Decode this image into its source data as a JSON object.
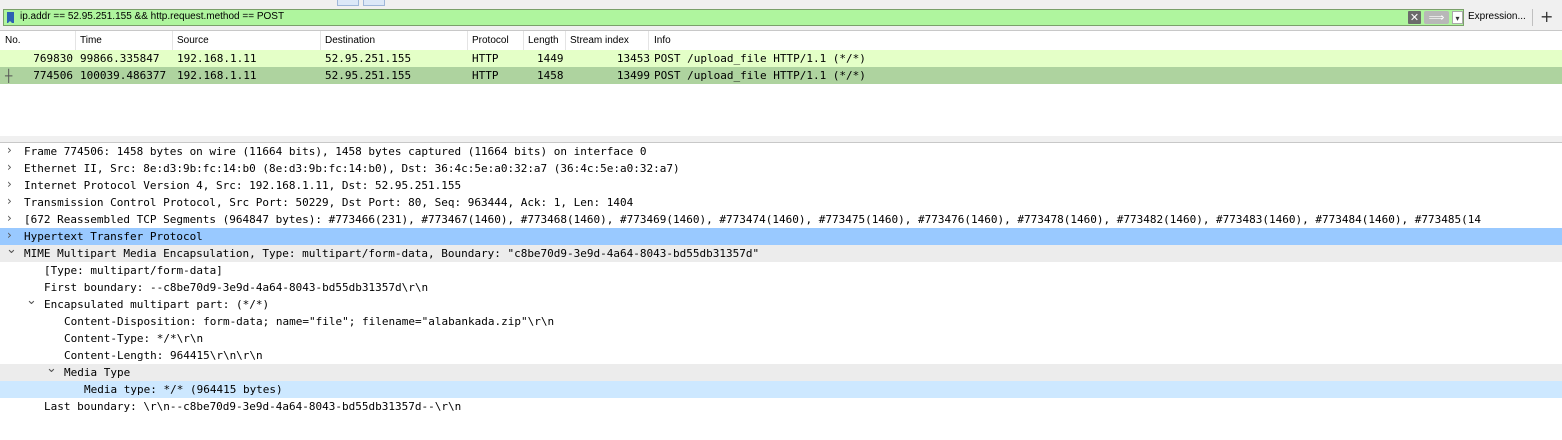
{
  "filter": {
    "value": "ip.addr == 52.95.251.155 && http.request.method == POST",
    "expression_label": "Expression...",
    "add_label": "+",
    "clear_glyph": "✕",
    "apply_glyph": "⟹",
    "dropdown_glyph": "▾"
  },
  "packet_list": {
    "columns": [
      "No.",
      "Time",
      "Source",
      "Destination",
      "Protocol",
      "Length",
      "Stream index",
      "Info"
    ],
    "rows": [
      {
        "no": "769830",
        "time": "99866.335847",
        "source": "192.168.1.11",
        "destination": "52.95.251.155",
        "protocol": "HTTP",
        "length": "1449",
        "stream": "13453",
        "info": "POST /upload_file HTTP/1.1  (*/*)"
      },
      {
        "no": "774506",
        "time": "100039.486377",
        "source": "192.168.1.11",
        "destination": "52.95.251.155",
        "protocol": "HTTP",
        "length": "1458",
        "stream": "13499",
        "info": "POST /upload_file HTTP/1.1  (*/*)"
      }
    ]
  },
  "details": {
    "rows": [
      {
        "arrow": "›",
        "text": "Frame 774506: 1458 bytes on wire (11664 bits), 1458 bytes captured (11664 bits) on interface 0"
      },
      {
        "arrow": "›",
        "text": "Ethernet II, Src: 8e:d3:9b:fc:14:b0 (8e:d3:9b:fc:14:b0), Dst: 36:4c:5e:a0:32:a7 (36:4c:5e:a0:32:a7)"
      },
      {
        "arrow": "›",
        "text": "Internet Protocol Version 4, Src: 192.168.1.11, Dst: 52.95.251.155"
      },
      {
        "arrow": "›",
        "text": "Transmission Control Protocol, Src Port: 50229, Dst Port: 80, Seq: 963444, Ack: 1, Len: 1404"
      },
      {
        "arrow": "›",
        "text": "[672 Reassembled TCP Segments (964847 bytes): #773466(231), #773467(1460), #773468(1460), #773469(1460), #773474(1460), #773475(1460), #773476(1460), #773478(1460), #773482(1460), #773483(1460), #773484(1460), #773485(14"
      },
      {
        "arrow": "›",
        "text": "Hypertext Transfer Protocol"
      },
      {
        "arrow": "⌄",
        "text": "MIME Multipart Media Encapsulation, Type: multipart/form-data, Boundary: \"c8be70d9-3e9d-4a64-8043-bd55db31357d\""
      },
      {
        "arrow": "",
        "text": "[Type: multipart/form-data]"
      },
      {
        "arrow": "",
        "text": "First boundary: --c8be70d9-3e9d-4a64-8043-bd55db31357d\\r\\n"
      },
      {
        "arrow": "⌄",
        "text": "Encapsulated multipart part:  (*/*)"
      },
      {
        "arrow": "",
        "text": "Content-Disposition: form-data; name=\"file\"; filename=\"alabankada.zip\"\\r\\n"
      },
      {
        "arrow": "",
        "text": "Content-Type: */*\\r\\n"
      },
      {
        "arrow": "",
        "text": "Content-Length: 964415\\r\\n\\r\\n"
      },
      {
        "arrow": "⌄",
        "text": "Media Type"
      },
      {
        "arrow": "",
        "text": "Media type: */* (964415 bytes)"
      },
      {
        "arrow": "",
        "text": "Last boundary: \\r\\n--c8be70d9-3e9d-4a64-8043-bd55db31357d--\\r\\n"
      }
    ]
  },
  "colors": {
    "filter_valid": "#aff59e",
    "row_http": "#e4ffc7",
    "row_selected": "#aed39f",
    "detail_selected": "#99c9ff"
  }
}
